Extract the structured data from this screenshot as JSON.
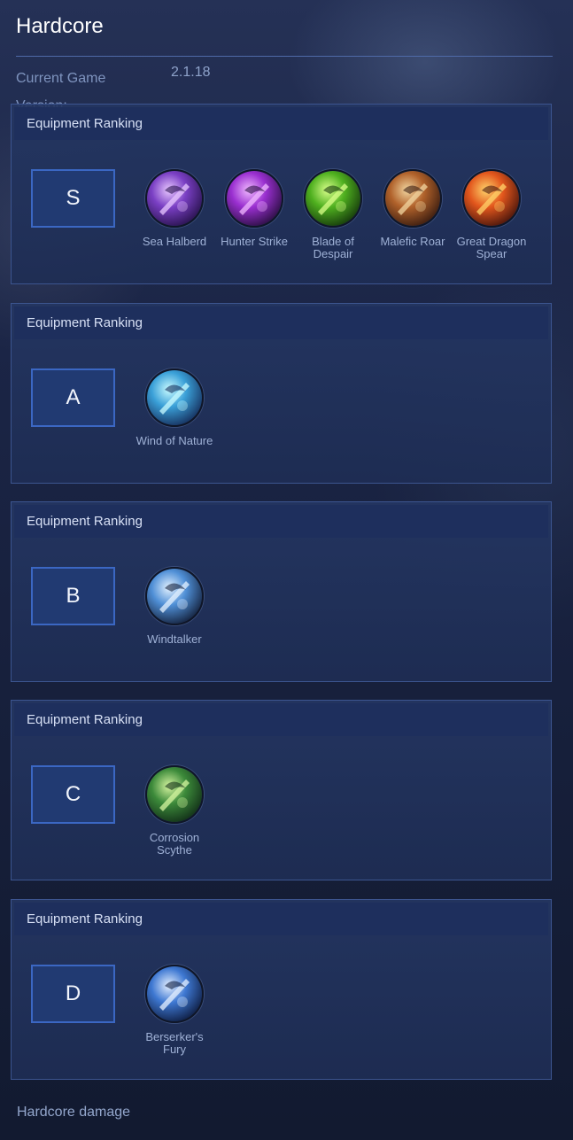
{
  "page": {
    "title": "Hardcore",
    "version_label": "Current Game Version:",
    "version_value": "2.1.18",
    "footer_text": "Hardcore damage"
  },
  "tiers": [
    {
      "header": "Equipment Ranking",
      "tier": "S",
      "items": [
        {
          "name": "Sea Halberd",
          "icon": "sea-halberd-icon",
          "colors": [
            "#e8c7ff",
            "#7a3fc4",
            "#2a1350"
          ]
        },
        {
          "name": "Hunter Strike",
          "icon": "hunter-strike-icon",
          "colors": [
            "#f0b8ff",
            "#9a2fd0",
            "#2c0f44"
          ]
        },
        {
          "name": "Blade of Despair",
          "icon": "blade-of-despair-icon",
          "colors": [
            "#d9ff8a",
            "#4fb01f",
            "#163a0c"
          ]
        },
        {
          "name": "Malefic Roar",
          "icon": "malefic-roar-icon",
          "colors": [
            "#f2d6a0",
            "#b0612a",
            "#3b1d10"
          ]
        },
        {
          "name": "Great Dragon Spear",
          "icon": "great-dragon-spear-icon",
          "colors": [
            "#ffd36a",
            "#e2561c",
            "#4a160c"
          ]
        }
      ]
    },
    {
      "header": "Equipment Ranking",
      "tier": "A",
      "items": [
        {
          "name": "Wind of Nature",
          "icon": "wind-of-nature-icon",
          "colors": [
            "#c9fbff",
            "#3aa0d8",
            "#16305e"
          ]
        }
      ]
    },
    {
      "header": "Equipment Ranking",
      "tier": "B",
      "items": [
        {
          "name": "Windtalker",
          "icon": "windtalker-icon",
          "colors": [
            "#e4f2ff",
            "#4f8fd6",
            "#15233f"
          ]
        }
      ]
    },
    {
      "header": "Equipment Ranking",
      "tier": "C",
      "items": [
        {
          "name": "Corrosion Scythe",
          "icon": "corrosion-scythe-icon",
          "colors": [
            "#d6f5a0",
            "#3c8a3a",
            "#123018"
          ]
        }
      ]
    },
    {
      "header": "Equipment Ranking",
      "tier": "D",
      "items": [
        {
          "name": "Berserker's Fury",
          "icon": "berserkers-fury-icon",
          "colors": [
            "#e6f0ff",
            "#3e78d2",
            "#0f1f45"
          ]
        }
      ]
    }
  ]
}
